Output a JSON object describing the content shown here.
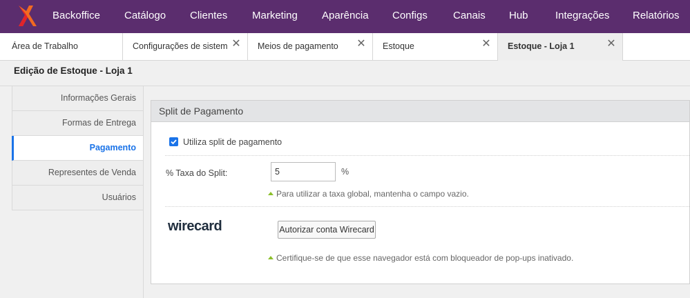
{
  "nav": {
    "logo": "logo-x-icon",
    "items": [
      "Backoffice",
      "Catálogo",
      "Clientes",
      "Marketing",
      "Aparência",
      "Configs",
      "Canais",
      "Hub",
      "Integrações",
      "Relatórios"
    ]
  },
  "tabs": [
    {
      "label": "Área de Trabalho",
      "closable": false
    },
    {
      "label": "Configurações de sistema",
      "closable": true
    },
    {
      "label": "Meios de pagamento",
      "closable": true
    },
    {
      "label": "Estoque",
      "closable": true
    },
    {
      "label": "Estoque - Loja 1",
      "closable": true,
      "active": true
    }
  ],
  "page": {
    "title": "Edição de Estoque - Loja 1"
  },
  "sidebar": {
    "items": [
      {
        "label": "Informações Gerais"
      },
      {
        "label": "Formas de Entrega"
      },
      {
        "label": "Pagamento",
        "active": true
      },
      {
        "label": "Representes de Venda"
      },
      {
        "label": "Usuários"
      }
    ]
  },
  "panel": {
    "title": "Split de Pagamento",
    "checkbox_label": "Utiliza split de pagamento",
    "checkbox_checked": true,
    "fee_label": "% Taxa do Split:",
    "fee_value": "5",
    "fee_unit": "%",
    "fee_hint": "Para utilizar a taxa global, mantenha o campo vazio.",
    "wirecard_logo": "wirecard",
    "wirecard_button": "Autorizar conta Wirecard",
    "popup_hint": "Certifique-se de que esse navegador está com bloqueador de pop-ups inativado."
  },
  "colors": {
    "topbar": "#5b2d6e",
    "accent": "#1a73e8",
    "logo_orange": "#f26a21",
    "logo_red": "#e2232a",
    "hint_arrow": "#8bbf2a"
  }
}
